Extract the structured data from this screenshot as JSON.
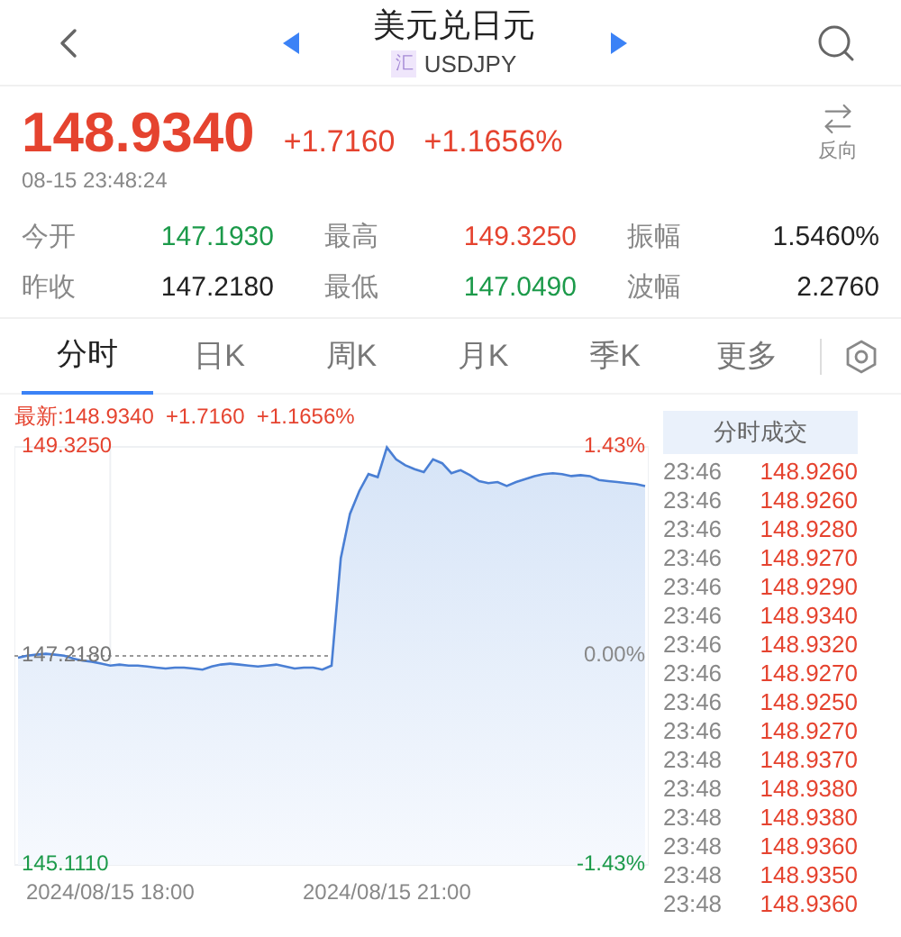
{
  "header": {
    "title": "美元兑日元",
    "badge": "汇",
    "code": "USDJPY"
  },
  "quote": {
    "price": "148.9340",
    "change": "+1.7160",
    "percent": "+1.1656%",
    "time": "08-15 23:48:24",
    "invert_label": "反向"
  },
  "stats": [
    {
      "label": "今开",
      "value": "147.1930",
      "kind": "down"
    },
    {
      "label": "最高",
      "value": "149.3250",
      "kind": "up"
    },
    {
      "label": "振幅",
      "value": "1.5460%",
      "kind": "flat"
    },
    {
      "label": "昨收",
      "value": "147.2180",
      "kind": "flat"
    },
    {
      "label": "最低",
      "value": "147.0490",
      "kind": "down"
    },
    {
      "label": "波幅",
      "value": "2.2760",
      "kind": "flat"
    }
  ],
  "tabs": [
    {
      "label": "分时",
      "selected": true
    },
    {
      "label": "日K",
      "selected": false
    },
    {
      "label": "周K",
      "selected": false
    },
    {
      "label": "月K",
      "selected": false
    },
    {
      "label": "季K",
      "selected": false
    },
    {
      "label": "更多",
      "selected": false
    }
  ],
  "chart": {
    "latest": "最新:148.9340  +1.7160  +1.1656%",
    "percent_labels": [
      {
        "text": "1.43%",
        "kind": "up"
      },
      {
        "text": "0.00%",
        "kind": "flat"
      },
      {
        "text": "-1.43%",
        "kind": "down"
      }
    ],
    "chart_data": {
      "type": "area",
      "ylim": [
        145.111,
        149.325
      ],
      "categories": [
        null,
        null,
        null,
        null,
        null,
        null,
        null,
        null,
        null,
        null,
        "2024/08/15 18:00",
        null,
        null,
        null,
        null,
        null,
        null,
        null,
        null,
        null,
        null,
        null,
        null,
        null,
        null,
        null,
        null,
        null,
        null,
        null,
        null,
        null,
        null,
        null,
        null,
        null,
        null,
        null,
        null,
        null,
        "2024/08/15 21:00",
        null,
        null,
        null,
        null,
        null,
        null,
        null,
        null,
        null,
        null,
        null,
        null,
        null,
        null,
        null,
        null,
        null,
        null,
        null,
        null,
        null,
        null,
        null,
        null,
        null,
        null,
        null,
        null
      ],
      "yticks": [
        {
          "value": 149.325,
          "label": "149.3250"
        },
        {
          "value": 147.218,
          "label": "147.2180"
        },
        {
          "value": 145.111,
          "label": "145.1110"
        }
      ],
      "series": [
        {
          "color": "#4a7fd4",
          "values": [
            147.2,
            147.22,
            147.23,
            147.24,
            147.23,
            147.22,
            147.19,
            147.17,
            147.16,
            147.14,
            147.12,
            147.13,
            147.12,
            147.12,
            147.11,
            147.1,
            147.09,
            147.1,
            147.1,
            147.09,
            147.08,
            147.11,
            147.13,
            147.14,
            147.13,
            147.12,
            147.11,
            147.12,
            147.13,
            147.11,
            147.09,
            147.1,
            147.1,
            147.08,
            147.12,
            148.2,
            148.65,
            148.88,
            149.05,
            149.02,
            149.32,
            149.2,
            149.14,
            149.1,
            149.07,
            149.2,
            149.16,
            149.06,
            149.09,
            149.04,
            148.98,
            148.96,
            148.97,
            148.93,
            148.97,
            149.0,
            149.03,
            149.05,
            149.06,
            149.05,
            149.03,
            149.04,
            149.03,
            148.99,
            148.98,
            148.97,
            148.96,
            148.95,
            148.93
          ]
        }
      ]
    }
  },
  "ticks": {
    "title": "分时成交",
    "rows": [
      {
        "time": "23:46",
        "price": "148.9260"
      },
      {
        "time": "23:46",
        "price": "148.9260"
      },
      {
        "time": "23:46",
        "price": "148.9280"
      },
      {
        "time": "23:46",
        "price": "148.9270"
      },
      {
        "time": "23:46",
        "price": "148.9290"
      },
      {
        "time": "23:46",
        "price": "148.9340"
      },
      {
        "time": "23:46",
        "price": "148.9320"
      },
      {
        "time": "23:46",
        "price": "148.9270"
      },
      {
        "time": "23:46",
        "price": "148.9250"
      },
      {
        "time": "23:46",
        "price": "148.9270"
      },
      {
        "time": "23:48",
        "price": "148.9370"
      },
      {
        "time": "23:48",
        "price": "148.9380"
      },
      {
        "time": "23:48",
        "price": "148.9380"
      },
      {
        "time": "23:48",
        "price": "148.9360"
      },
      {
        "time": "23:48",
        "price": "148.9350"
      },
      {
        "time": "23:48",
        "price": "148.9360"
      }
    ]
  }
}
